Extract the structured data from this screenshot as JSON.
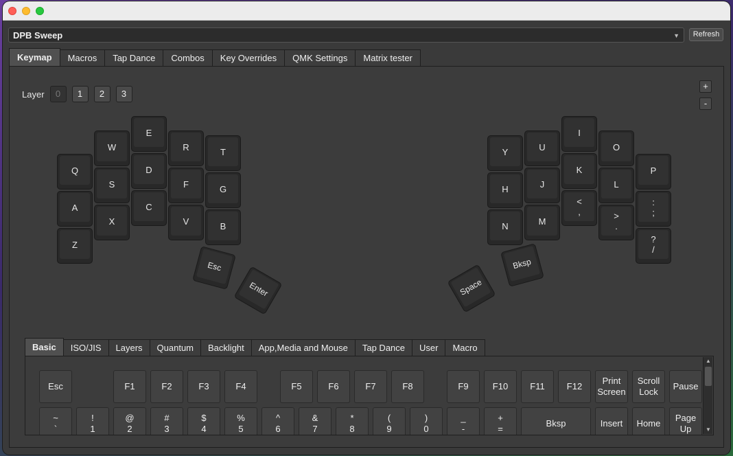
{
  "device": {
    "name": "DPB Sweep",
    "refresh_label": "Refresh"
  },
  "tabs": [
    "Keymap",
    "Macros",
    "Tap Dance",
    "Combos",
    "Key Overrides",
    "QMK Settings",
    "Matrix tester"
  ],
  "layer": {
    "label": "Layer",
    "buttons": [
      "0",
      "1",
      "2",
      "3"
    ],
    "active": "0",
    "zoom_in": "+",
    "zoom_out": "-"
  },
  "keyboard": {
    "keys": [
      "Q",
      "W",
      "E",
      "R",
      "T",
      "S",
      "D",
      "F",
      "G",
      "A",
      "X",
      "C",
      "V",
      "B",
      "Z",
      "Esc",
      "Enter",
      "Y",
      "U",
      "I",
      "O",
      "P",
      "H",
      "J",
      "K",
      "L",
      ":\n;",
      "N",
      "M",
      "<\n,",
      ">\n.",
      "?\n/",
      "Bksp",
      "Space"
    ]
  },
  "keycode_tabs": [
    "Basic",
    "ISO/JIS",
    "Layers",
    "Quantum",
    "Backlight",
    "App,Media and Mouse",
    "Tap Dance",
    "User",
    "Macro"
  ],
  "keycodes": {
    "row1": [
      "Esc",
      "F1",
      "F2",
      "F3",
      "F4",
      "F5",
      "F6",
      "F7",
      "F8",
      "F9",
      "F10",
      "F11",
      "F12",
      "Print\nScreen",
      "Scroll\nLock",
      "Pause"
    ],
    "row2": [
      "~\n`",
      "!\n1",
      "@\n2",
      "#\n3",
      "$\n4",
      "%\n5",
      "^\n6",
      "&\n7",
      "*\n8",
      "(\n9",
      ")\n0",
      "_\n-",
      "+\n=",
      "Bksp",
      "Insert",
      "Home",
      "Page\nUp"
    ]
  },
  "colors": {
    "window_bg": "#3a3a3a",
    "key_bg": "#313131",
    "titlebar": "#ececec"
  }
}
